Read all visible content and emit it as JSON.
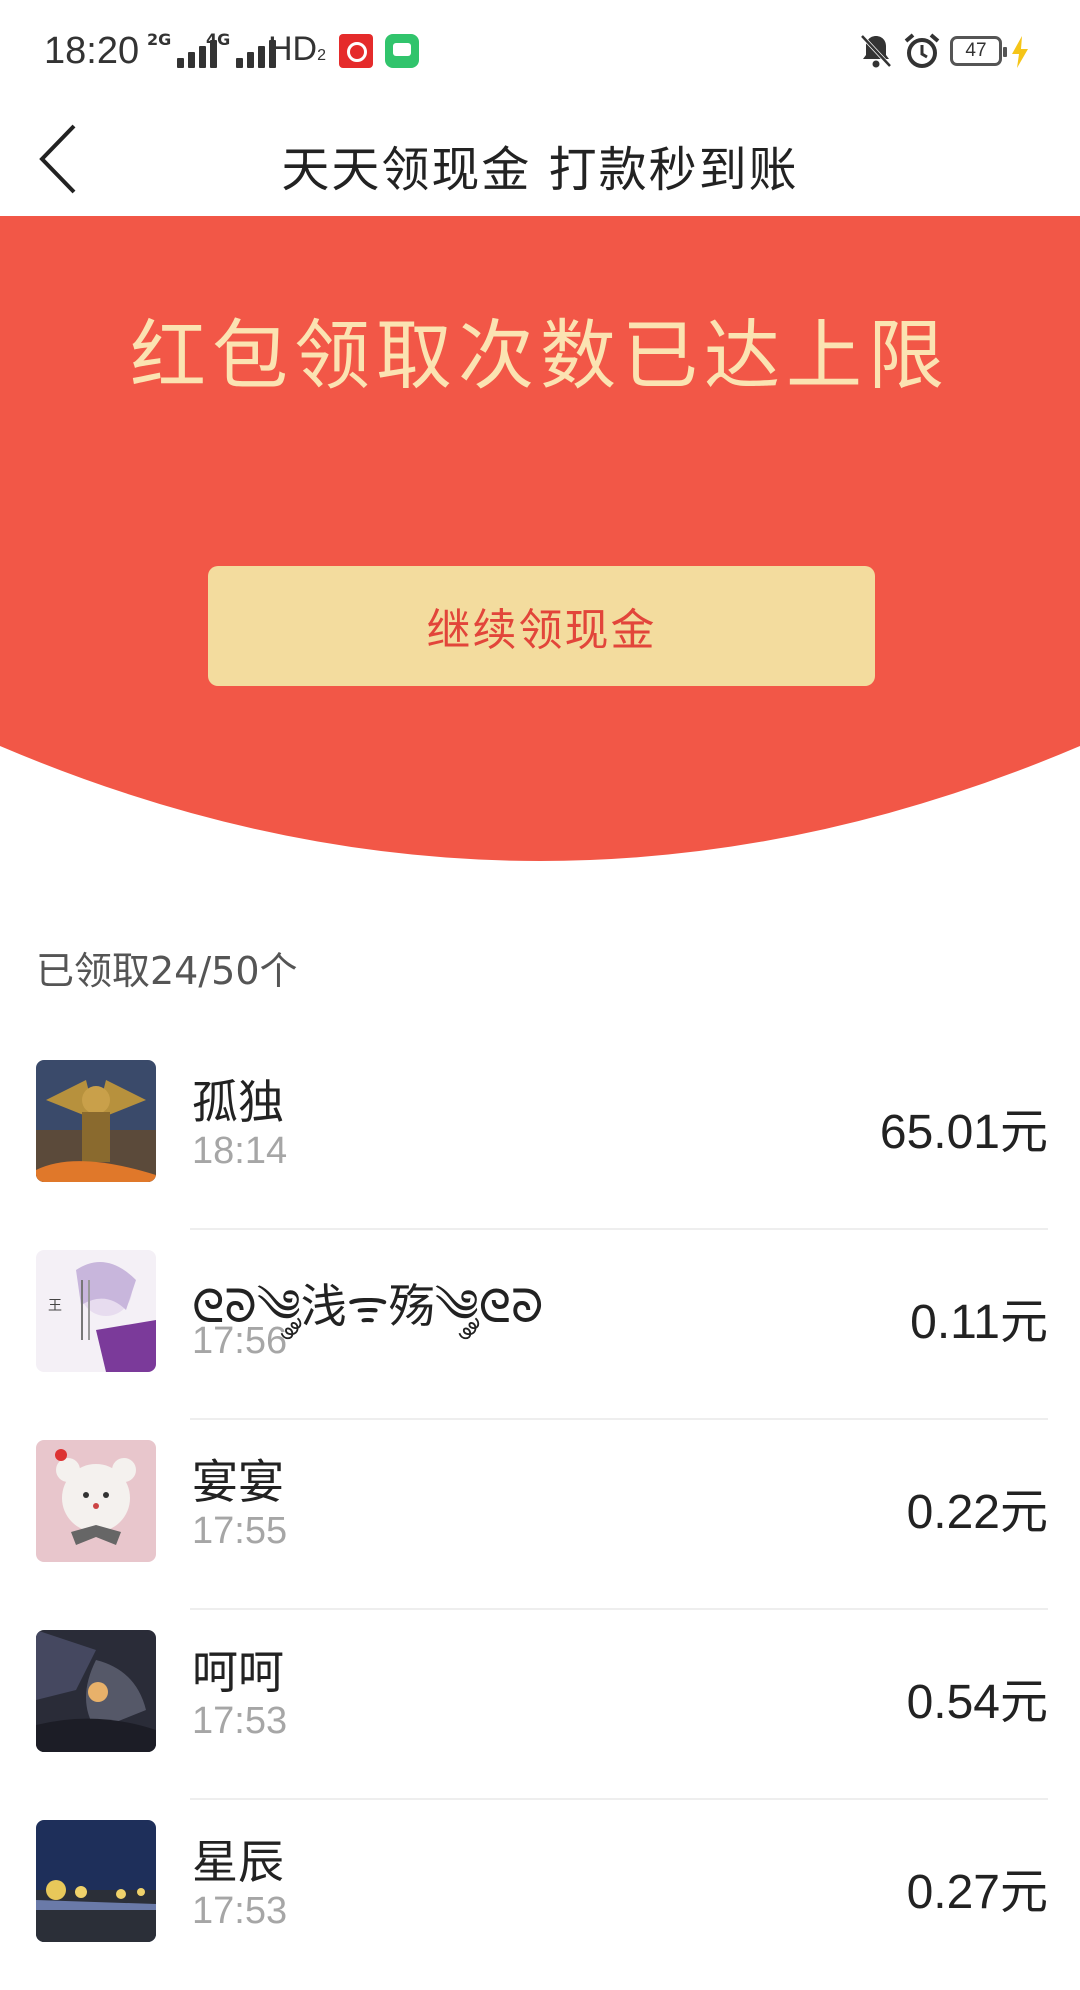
{
  "status_bar": {
    "time": "18:20",
    "network1": "2G",
    "network2": "4G",
    "hd": "HD",
    "hd_sub": "2",
    "battery": "47",
    "icons": [
      "netease-music-icon",
      "messages-icon",
      "mute-bell-icon",
      "alarm-icon",
      "battery-icon",
      "charging-bolt-icon"
    ]
  },
  "header": {
    "title": "天天领现金 打款秒到账",
    "back_icon": "back-chevron-icon"
  },
  "banner": {
    "title": "红包领取次数已达上限",
    "button_label": "继续领现金",
    "background_color": "#f25747",
    "title_color": "#fbe3b2",
    "button_color": "#f3dc9e",
    "button_text_color": "#e2453a"
  },
  "claimed_count": "已领取24/50个",
  "records": [
    {
      "name": "孤独",
      "time": "18:14",
      "amount": "65.01元",
      "avatar": "armored-hero-avatar"
    },
    {
      "name": "ᘓᘐ༄༘浅ᯤ殇༄༘ᘓᘐ",
      "time": "17:56",
      "amount": "0.11元",
      "avatar": "anime-character-avatar"
    },
    {
      "name": "宴宴",
      "time": "17:55",
      "amount": "0.22元",
      "avatar": "teddy-bear-avatar"
    },
    {
      "name": "呵呵",
      "time": "17:53",
      "amount": "0.54元",
      "avatar": "dark-portrait-avatar"
    },
    {
      "name": "星辰",
      "time": "17:53",
      "amount": "0.27元",
      "avatar": "night-city-avatar"
    }
  ]
}
